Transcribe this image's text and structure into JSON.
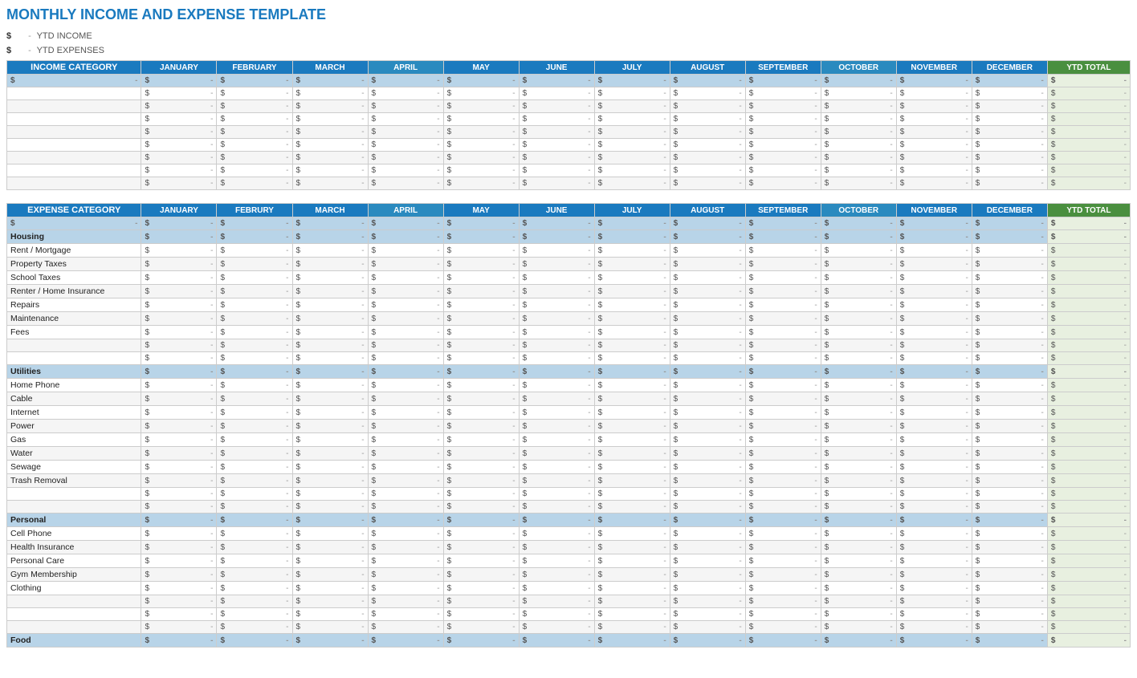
{
  "title": "MONTHLY INCOME AND EXPENSE TEMPLATE",
  "summary": {
    "ytd_income_label": "YTD INCOME",
    "ytd_expenses_label": "YTD EXPENSES",
    "dollar_sign": "$",
    "dash": "-"
  },
  "months": [
    "JANUARY",
    "FEBRUARY",
    "MARCH",
    "APRIL",
    "MAY",
    "JUNE",
    "JULY",
    "AUGUST",
    "SEPTEMBER",
    "OCTOBER",
    "NOVEMBER",
    "DECEMBER"
  ],
  "months_expense": [
    "JANUARY",
    "FEBRURY",
    "MARCH",
    "APRIL",
    "MAY",
    "JUNE",
    "JULY",
    "AUGUST",
    "SEPTEMBER",
    "OCTOBER",
    "NOVEMBER",
    "DECEMBER"
  ],
  "ytd_label": "YTD TOTAL",
  "income_category_label": "INCOME CATEGORY",
  "expense_category_label": "EXPENSE CATEGORY",
  "income_rows": [
    {
      "label": "",
      "values": [
        "-",
        "-",
        "-",
        "-",
        "-",
        "-",
        "-",
        "-",
        "-",
        "-",
        "-",
        "-"
      ],
      "ytd": "-"
    },
    {
      "label": "",
      "values": [
        "-",
        "-",
        "-",
        "-",
        "-",
        "-",
        "-",
        "-",
        "-",
        "-",
        "-",
        "-"
      ],
      "ytd": "-"
    },
    {
      "label": "",
      "values": [
        "-",
        "-",
        "-",
        "-",
        "-",
        "-",
        "-",
        "-",
        "-",
        "-",
        "-",
        "-"
      ],
      "ytd": "-"
    },
    {
      "label": "",
      "values": [
        "-",
        "-",
        "-",
        "-",
        "-",
        "-",
        "-",
        "-",
        "-",
        "-",
        "-",
        "-"
      ],
      "ytd": "-"
    },
    {
      "label": "",
      "values": [
        "-",
        "-",
        "-",
        "-",
        "-",
        "-",
        "-",
        "-",
        "-",
        "-",
        "-",
        "-"
      ],
      "ytd": "-"
    },
    {
      "label": "",
      "values": [
        "-",
        "-",
        "-",
        "-",
        "-",
        "-",
        "-",
        "-",
        "-",
        "-",
        "-",
        "-"
      ],
      "ytd": "-"
    },
    {
      "label": "",
      "values": [
        "-",
        "-",
        "-",
        "-",
        "-",
        "-",
        "-",
        "-",
        "-",
        "-",
        "-",
        "-"
      ],
      "ytd": "-"
    },
    {
      "label": "",
      "values": [
        "-",
        "-",
        "-",
        "-",
        "-",
        "-",
        "-",
        "-",
        "-",
        "-",
        "-",
        "-"
      ],
      "ytd": "-"
    }
  ],
  "expense_sections": [
    {
      "name": "Housing",
      "items": [
        "Rent / Mortgage",
        "Property Taxes",
        "School Taxes",
        "Renter / Home Insurance",
        "Repairs",
        "Maintenance",
        "Fees",
        "",
        ""
      ]
    },
    {
      "name": "Utilities",
      "items": [
        "Home Phone",
        "Cable",
        "Internet",
        "Power",
        "Gas",
        "Water",
        "Sewage",
        "Trash Removal",
        "",
        ""
      ]
    },
    {
      "name": "Personal",
      "items": [
        "Cell Phone",
        "Health Insurance",
        "Personal Care",
        "Gym Membership",
        "Clothing",
        "",
        "",
        ""
      ]
    },
    {
      "name": "Food",
      "items": []
    }
  ]
}
